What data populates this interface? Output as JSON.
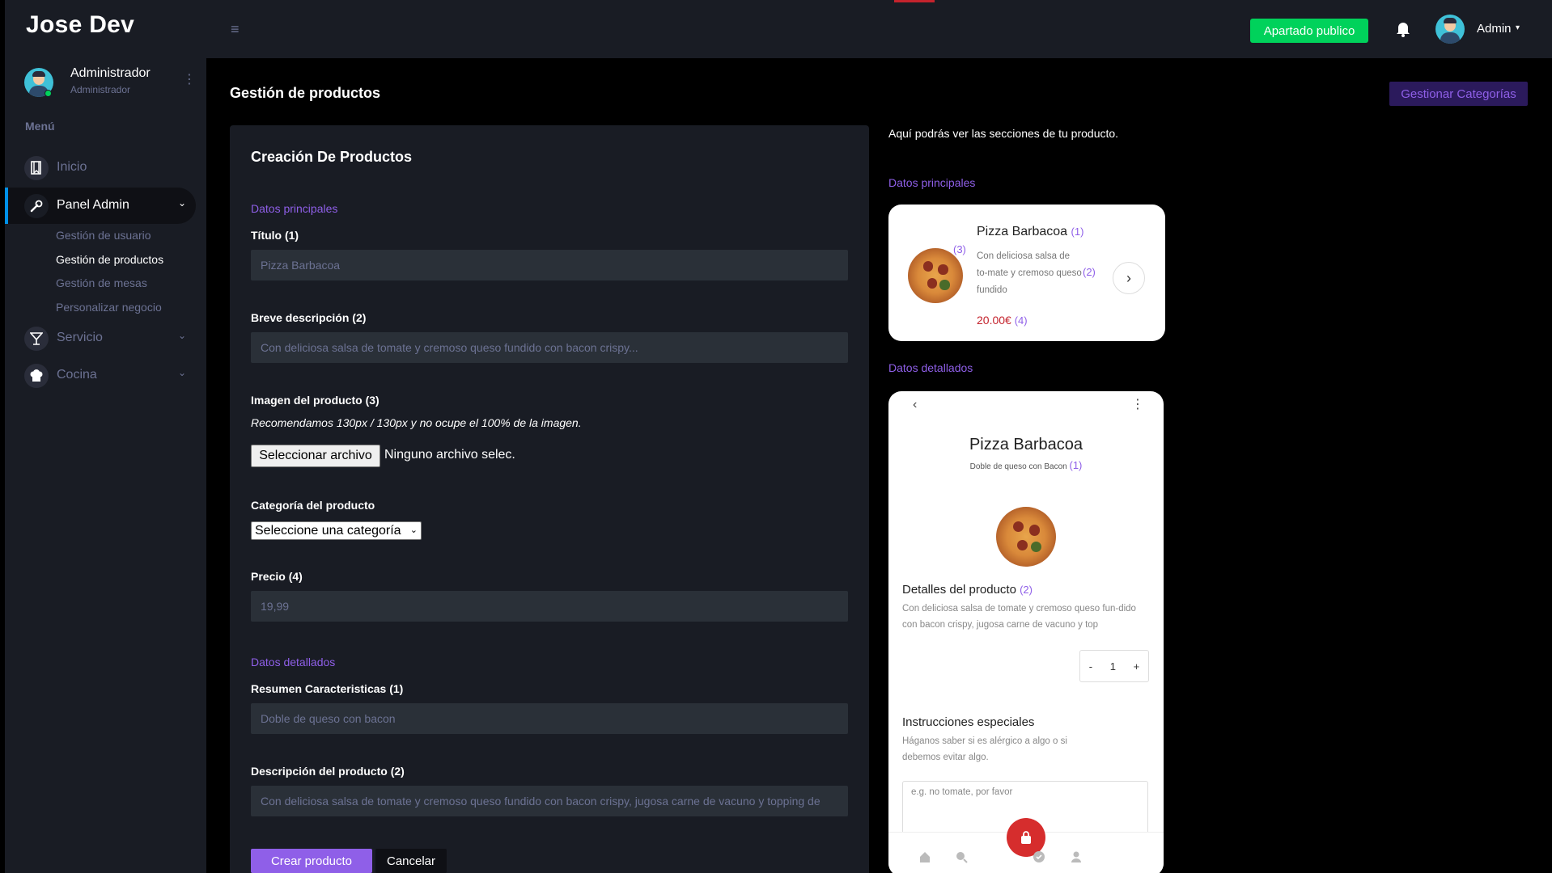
{
  "app": {
    "brand": "Jose Dev"
  },
  "sidebar": {
    "profile": {
      "name": "Administrador",
      "role": "Administrador"
    },
    "menu_title": "Menú",
    "items": [
      {
        "label": "Inicio",
        "icon": "bookmark-icon"
      },
      {
        "label": "Panel Admin",
        "icon": "wrench-icon",
        "active": true
      },
      {
        "label": "Servicio",
        "icon": "cocktail-icon"
      },
      {
        "label": "Cocina",
        "icon": "chef-hat-icon"
      }
    ],
    "subitems": [
      "Gestión de usuario",
      "Gestión de productos",
      "Gestión de mesas",
      "Personalizar negocio"
    ]
  },
  "topbar": {
    "public_button": "Apartado publico",
    "user": "Admin"
  },
  "main": {
    "title": "Gestión de productos",
    "categories_button": "Gestionar Categorías"
  },
  "form": {
    "title": "Creación De Productos",
    "section_main": "Datos principales",
    "title_label": "Título (1)",
    "title_placeholder": "Pizza Barbacoa",
    "short_desc_label": "Breve descripción (2)",
    "short_desc_placeholder": "Con deliciosa salsa de tomate y cremoso queso fundido con bacon crispy...",
    "image_label": "Imagen del producto (3)",
    "image_hint": "Recomendamos 130px / 130px y no ocupe el 100% de la imagen.",
    "file_button": "Seleccionar archivo",
    "file_status": "Ninguno archivo selec.",
    "category_label": "Categoría del producto",
    "category_select": "Seleccione una categoría",
    "price_label": "Precio (4)",
    "price_placeholder": "19,99",
    "section_detail": "Datos detallados",
    "summary_label": "Resumen Caracteristicas (1)",
    "summary_placeholder": "Doble de queso con bacon",
    "description_label": "Descripción del producto (2)",
    "description_placeholder": "Con deliciosa salsa de tomate y cremoso queso fundido con bacon crispy, jugosa carne de vacuno y topping de",
    "create_button": "Crear producto",
    "cancel_button": "Cancelar"
  },
  "preview": {
    "intro": "Aquí podrás ver las secciones de tu producto.",
    "main_label": "Datos principales",
    "detail_label": "Datos detallados",
    "card": {
      "title": "Pizza Barbacoa",
      "title_mark": "(1)",
      "image_mark": "(3)",
      "desc": "Con deliciosa salsa de to-mate y cremoso queso fundido",
      "desc_mark": "(2)",
      "price": "20.00€",
      "price_mark": "(4)"
    },
    "phone": {
      "title": "Pizza Barbacoa",
      "subtitle": "Doble de queso con Bacon",
      "subtitle_mark": "(1)",
      "details_heading": "Detalles del producto",
      "details_mark": "(2)",
      "details_text": "Con deliciosa salsa de tomate y cremoso queso fun-dido con bacon crispy, jugosa carne de vacuno y top",
      "qty_minus": "-",
      "qty_value": "1",
      "qty_plus": "+",
      "instructions_heading": "Instrucciones especiales",
      "instructions_text": "Háganos saber si es alérgico a algo o si debemos evitar algo.",
      "instructions_placeholder": "e.g. no tomate, por favor"
    }
  },
  "colors": {
    "accent": "#8f5fe8",
    "success": "#00d25b",
    "sidebar": "#191c24",
    "price": "#c4232d"
  }
}
